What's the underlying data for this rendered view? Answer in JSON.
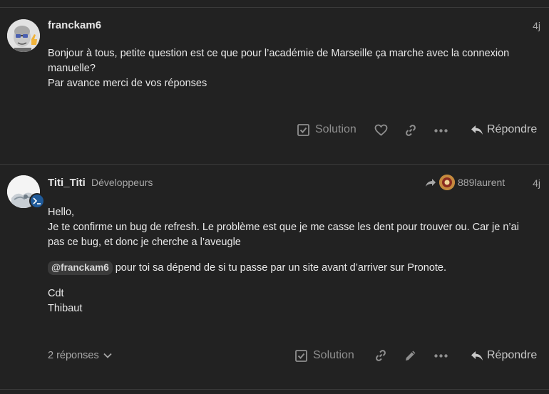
{
  "posts": [
    {
      "username": "franckam6",
      "date": "4j",
      "body_lines": [
        "Bonjour à tous, petite question est ce que pour l’académie de Marseille ça marche avec la connexion",
        "manuelle?",
        "Par avance merci de vos réponses"
      ],
      "actions": {
        "solution_label": "Solution",
        "reply_label": "Répondre"
      }
    },
    {
      "username": "Titi_Titi",
      "user_title": "Développeurs",
      "reply_to_user": "889laurent",
      "date": "4j",
      "body_p1": [
        "Hello,",
        "Je te confirme un bug de refresh. Le problème est que je me casse les dent pour trouver ou. Car je n’ai",
        "pas ce bug, et donc je cherche a l’aveugle"
      ],
      "mention": "@franckam6",
      "body_p2_rest": " pour toi sa dépend de si tu passe par un site avant d’arriver sur Pronote.",
      "body_p3": [
        "Cdt",
        "Thibaut"
      ],
      "replies_label": "2 réponses",
      "actions": {
        "solution_label": "Solution",
        "reply_label": "Répondre"
      }
    }
  ],
  "colors": {
    "background": "#222222",
    "text": "#e9e9e9",
    "muted": "#a8a8a8",
    "icon": "#8f8f8f"
  }
}
